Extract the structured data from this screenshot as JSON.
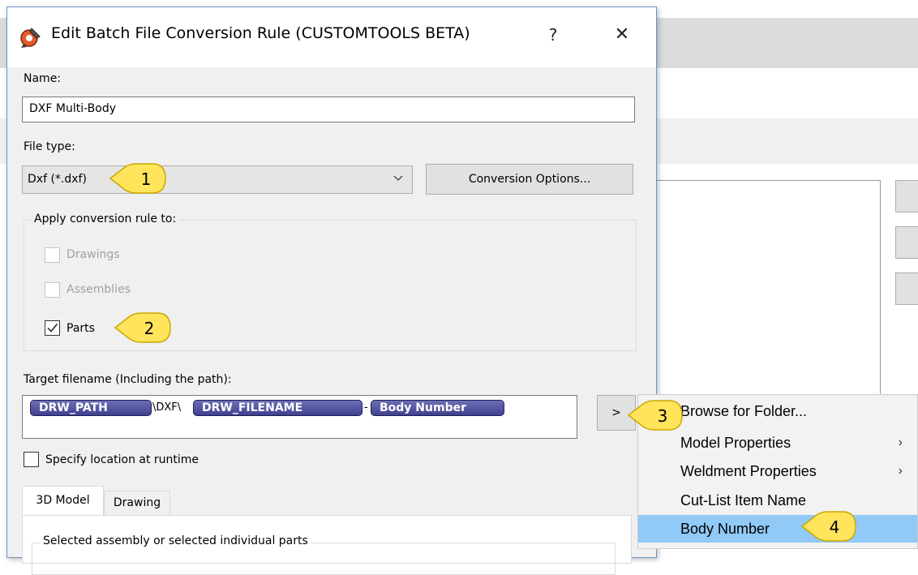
{
  "dialog": {
    "title": "Edit Batch File Conversion Rule (CUSTOMTOOLS BETA)",
    "help": "?",
    "close": "✕"
  },
  "name": {
    "label": "Name:",
    "value": "DXF Multi-Body"
  },
  "file_type": {
    "label": "File type:",
    "value": "Dxf (*.dxf)",
    "conversion_options": "Conversion Options..."
  },
  "apply": {
    "label": "Apply conversion rule to:",
    "drawings": {
      "label": "Drawings",
      "checked": false,
      "enabled": false
    },
    "assemblies": {
      "label": "Assemblies",
      "checked": false,
      "enabled": false
    },
    "parts": {
      "label": "Parts",
      "checked": true,
      "enabled": true
    }
  },
  "target": {
    "label": "Target filename (Including the path):",
    "tokens": [
      "DRW_PATH",
      "DRW_FILENAME",
      "Body Number"
    ],
    "separators": [
      "\\DXF\\",
      "-"
    ],
    "arrow": ">"
  },
  "runtime": {
    "label": "Specify location at runtime",
    "checked": false
  },
  "tabs": {
    "model": "3D Model",
    "drawing": "Drawing"
  },
  "selection_group": {
    "label": "Selected assembly or selected individual parts"
  },
  "menu": {
    "items": [
      {
        "label": "Browse for Folder...",
        "submenu": false
      },
      {
        "label": "Model Properties",
        "submenu": true
      },
      {
        "label": "Weldment Properties",
        "submenu": true
      },
      {
        "label": "Cut-List Item Name",
        "submenu": false
      },
      {
        "label": "Body Number",
        "submenu": false,
        "selected": true
      }
    ]
  },
  "callouts": [
    "1",
    "2",
    "3",
    "4"
  ],
  "colors": {
    "callout": "#ffe45c",
    "token": "#4a4c9c",
    "menu_highlight": "#91c9f7"
  }
}
